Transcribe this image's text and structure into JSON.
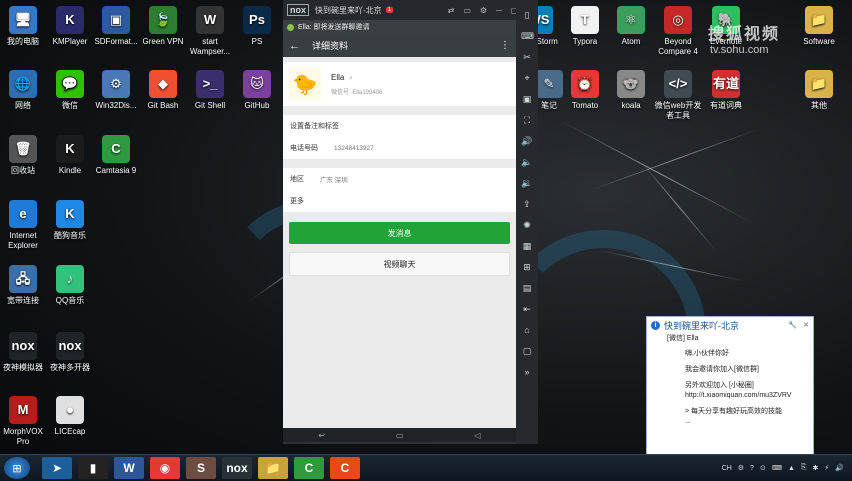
{
  "desktop": {
    "icons_left": [
      {
        "label": "我的电脑",
        "glyph": "🖥",
        "color": "#3a76c4"
      },
      {
        "label": "网络",
        "glyph": "🌐",
        "color": "#2f6db0"
      },
      {
        "label": "回收站",
        "glyph": "🗑",
        "color": "#555"
      },
      {
        "label": "Internet Explorer",
        "glyph": "e",
        "color": "#1e7ad6"
      },
      {
        "label": "宽带连接",
        "glyph": "🖧",
        "color": "#3c6fa5"
      },
      {
        "label": "夜神模拟器",
        "glyph": "nox",
        "color": "#1f2428"
      },
      {
        "label": "MorphVOX Pro",
        "glyph": "M",
        "color": "#b71c1c"
      }
    ],
    "icons_col2": [
      {
        "label": "KMPlayer",
        "glyph": "K",
        "color": "#2b2b6b"
      },
      {
        "label": "微信",
        "glyph": "💬",
        "color": "#2dc100"
      },
      {
        "label": "Kindle",
        "glyph": "K",
        "color": "#1b1b1b"
      },
      {
        "label": "酷狗音乐",
        "glyph": "K",
        "color": "#1e88e5"
      },
      {
        "label": "QQ音乐",
        "glyph": "♪",
        "color": "#31c27c"
      },
      {
        "label": "夜神多开器",
        "glyph": "nox",
        "color": "#1f2428"
      },
      {
        "label": "LICEcap",
        "glyph": "●",
        "color": "#e0e0e0"
      }
    ],
    "icons_col3": [
      {
        "label": "SDFormat...",
        "glyph": "▣",
        "color": "#2c5aa0"
      },
      {
        "label": "Win32Dis...",
        "glyph": "⚙",
        "color": "#4a78b4"
      },
      {
        "label": "Camtasia 9",
        "glyph": "C",
        "color": "#2e9a3d"
      }
    ],
    "icons_top": [
      {
        "label": "Green VPN",
        "glyph": "🍃",
        "color": "#2e7d32"
      },
      {
        "label": "start Wampser...",
        "glyph": "W",
        "color": "#333"
      },
      {
        "label": "PS",
        "glyph": "Ps",
        "color": "#0b2a4a"
      },
      {
        "label": "Git Bash",
        "glyph": "◆",
        "color": "#f05032"
      },
      {
        "label": "Git Shell",
        "glyph": ">_",
        "color": "#3c2d6e"
      },
      {
        "label": "GitHub",
        "glyph": "🐱",
        "color": "#7b3fa0"
      }
    ],
    "icons_right": [
      {
        "label": "WebStorm",
        "glyph": "WS",
        "color": "#0a7fb4"
      },
      {
        "label": "Typora",
        "glyph": "T",
        "color": "#f2f2f2"
      },
      {
        "label": "Atom",
        "glyph": "⚛",
        "color": "#3c9d5d"
      },
      {
        "label": "Beyond Compare 4",
        "glyph": "◎",
        "color": "#c62828"
      },
      {
        "label": "Evernote",
        "glyph": "🐘",
        "color": "#2dbe60"
      },
      {
        "label": "Software",
        "glyph": "📁",
        "color": "#d9b24a"
      },
      {
        "label": "Tomato",
        "glyph": "⏰",
        "color": "#e53935"
      },
      {
        "label": "koala",
        "glyph": "🐨",
        "color": "#888"
      },
      {
        "label": "微信web开发者工具",
        "glyph": "</>",
        "color": "#3f4a52"
      },
      {
        "label": "有道词典",
        "glyph": "有道",
        "color": "#d32f2f"
      },
      {
        "label": "其他",
        "glyph": "📁",
        "color": "#d9b24a"
      },
      {
        "label": "笔记",
        "glyph": "✎",
        "color": "#4a6a8a"
      }
    ]
  },
  "watermark": {
    "text": "搜狐视频",
    "url": "tv.sohu.com"
  },
  "nox": {
    "title": "快到碗里来吖-北京",
    "logo": "nox",
    "badge": "1",
    "controls": [
      "⇄",
      "▭",
      "⚙",
      "─",
      "▢",
      "✕"
    ],
    "notification": "Ella: 即将发送群聊邀请",
    "appbar_title": "详细资料",
    "profile": {
      "name": "Ella",
      "wechat_id": "微信号: Ella199406"
    },
    "rows": [
      {
        "label": "设置备注和标签",
        "value": ""
      },
      {
        "label": "电话号码",
        "value": "13248413927"
      },
      {
        "label": "地区",
        "value": "广东  深圳"
      },
      {
        "label": "更多",
        "value": ""
      }
    ],
    "send_button": "发消息",
    "video_button": "视频聊天",
    "navbar": [
      "↩",
      "▭",
      "◁"
    ],
    "side_tools": [
      "▯",
      "⌨",
      "✂",
      "⌖",
      "▣",
      "⛶",
      "🔊",
      "🔈",
      "🔉",
      "⇪",
      "✺",
      "▦",
      "⊞",
      "▤",
      "⇤",
      "⌂",
      "▢",
      "»"
    ]
  },
  "popup": {
    "title": "快到碗里来吖-北京",
    "subtitle": "[微信] Ella",
    "lines": [
      "嗨,小伙伴你好",
      "我会邀请你加入[微信群]",
      "另外欢迎加入 [小秘圈]",
      "http://t.xiaomiquan.com/mu3ZVRV",
      "> 每天分享有趣好玩高效的技能",
      "..."
    ],
    "controls": [
      "🔧",
      "✕"
    ]
  },
  "taskbar": {
    "apps": [
      {
        "glyph": "➤",
        "color": "#1b5e9a"
      },
      {
        "glyph": "▮",
        "color": "#222"
      },
      {
        "glyph": "W",
        "color": "#2b579a"
      },
      {
        "glyph": "◉",
        "color": "#e53935"
      },
      {
        "glyph": "S",
        "color": "#6d4c41"
      },
      {
        "glyph": "nox",
        "color": "#263238"
      },
      {
        "glyph": "📁",
        "color": "#c9a23b"
      },
      {
        "glyph": "C",
        "color": "#2e9a3d"
      },
      {
        "glyph": "C",
        "color": "#e64a19"
      }
    ],
    "tray": [
      "CH",
      "⚙",
      "?",
      "⊙",
      "⌨",
      "▲",
      "⎘",
      "✱",
      "⚡",
      "🔊"
    ]
  }
}
